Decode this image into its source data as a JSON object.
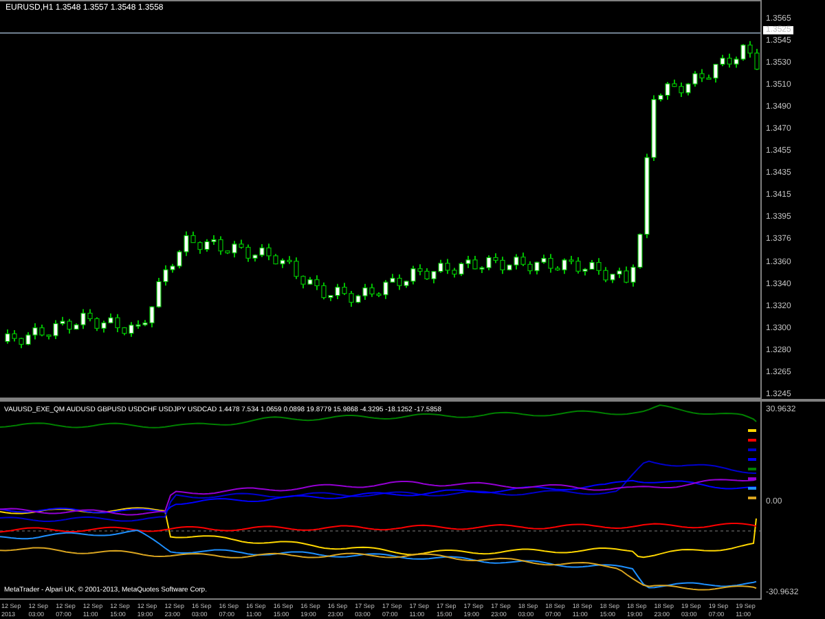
{
  "main_chart": {
    "title": "EURUSD,H1  1.3548 1.3557 1.3548 1.3558",
    "current_price": "1.3525",
    "price_scale": [
      "1.3565",
      "1.3545",
      "1.3530",
      "1.3510",
      "1.3490",
      "1.3470",
      "1.3455",
      "1.3435",
      "1.3415",
      "1.3395",
      "1.3376",
      "1.3360",
      "1.3340",
      "1.3320",
      "1.3300",
      "1.3280",
      "1.3265",
      "1.3245"
    ]
  },
  "indicator": {
    "title": "VAUUSD_EXE_QM AUDUSD GBPUSD USDCHF USDJPY USDCAD 1.4478 7.534 1.0659 0.0898 19.8779 15.9868 -4.3295 -18.1252 -17.5858",
    "scale": [
      "30.9632",
      "0.00",
      "-30.9632"
    ],
    "lines": [
      {
        "color": "#ffd700"
      },
      {
        "color": "#ff0000"
      },
      {
        "color": "#0000cd"
      },
      {
        "color": "#0000ff"
      },
      {
        "color": "#008000"
      },
      {
        "color": "#9400d3"
      },
      {
        "color": "#1e90ff"
      },
      {
        "color": "#daa520"
      }
    ]
  },
  "footer": "MetaTrader - Alpari UK, © 2001-2013, MetaQuotes Software Corp.",
  "time_axis": [
    "12 Sep 2013",
    "12 Sep 03:00",
    "12 Sep 07:00",
    "12 Sep 11:00",
    "12 Sep 15:00",
    "12 Sep 19:00",
    "12 Sep 23:00",
    "16 Sep 03:00",
    "16 Sep 07:00",
    "16 Sep 11:00",
    "16 Sep 15:00",
    "16 Sep 19:00",
    "16 Sep 23:00",
    "17 Sep 03:00",
    "17 Sep 07:00",
    "17 Sep 11:00",
    "17 Sep 15:00",
    "17 Sep 19:00",
    "17 Sep 23:00",
    "18 Sep 03:00",
    "18 Sep 07:00",
    "18 Sep 11:00",
    "18 Sep 15:00",
    "18 Sep 19:00",
    "18 Sep 23:00",
    "19 Sep 03:00",
    "19 Sep 07:00",
    "19 Sep 11:00"
  ]
}
